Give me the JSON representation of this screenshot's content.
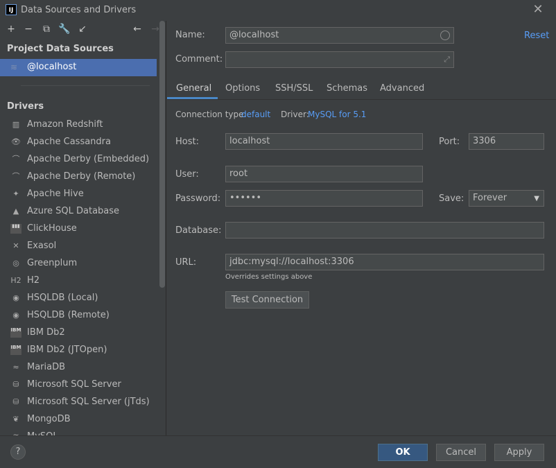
{
  "window": {
    "icon_text": "IJ",
    "title": "Data Sources and Drivers",
    "close_glyph": "✕"
  },
  "toolbar": {
    "icons": [
      {
        "name": "add-icon",
        "glyph": "+"
      },
      {
        "name": "remove-icon",
        "glyph": "−"
      },
      {
        "name": "copy-icon",
        "glyph": "⧉"
      },
      {
        "name": "wrench-icon",
        "glyph": "🔧"
      },
      {
        "name": "import-icon",
        "glyph": "↙"
      },
      {
        "name": "back-arrow-icon",
        "glyph": "←"
      },
      {
        "name": "forward-arrow-icon",
        "glyph": "→"
      }
    ]
  },
  "sidebar": {
    "project_title": "Project Data Sources",
    "selected_source": "@localhost",
    "drivers_title": "Drivers",
    "drivers": [
      {
        "label": "Amazon Redshift",
        "icon": "redshift-icon",
        "glyph": "▥"
      },
      {
        "label": "Apache Cassandra",
        "icon": "cassandra-icon",
        "glyph": "👁"
      },
      {
        "label": "Apache Derby (Embedded)",
        "icon": "derby-icon",
        "glyph": "⌒"
      },
      {
        "label": "Apache Derby (Remote)",
        "icon": "derby-icon",
        "glyph": "⌒"
      },
      {
        "label": "Apache Hive",
        "icon": "hive-icon",
        "glyph": "✦"
      },
      {
        "label": "Azure SQL Database",
        "icon": "azure-icon",
        "glyph": "▲"
      },
      {
        "label": "ClickHouse",
        "icon": "clickhouse-icon",
        "glyph": "▮▮▮"
      },
      {
        "label": "Exasol",
        "icon": "exasol-icon",
        "glyph": "✕"
      },
      {
        "label": "Greenplum",
        "icon": "greenplum-icon",
        "glyph": "◎"
      },
      {
        "label": "H2",
        "icon": "h2-icon",
        "glyph": "H2"
      },
      {
        "label": "HSQLDB (Local)",
        "icon": "hsqldb-icon",
        "glyph": "◉"
      },
      {
        "label": "HSQLDB (Remote)",
        "icon": "hsqldb-icon",
        "glyph": "◉"
      },
      {
        "label": "IBM Db2",
        "icon": "db2-icon",
        "glyph": "IBM"
      },
      {
        "label": "IBM Db2 (JTOpen)",
        "icon": "db2-icon",
        "glyph": "IBM"
      },
      {
        "label": "MariaDB",
        "icon": "mariadb-icon",
        "glyph": "≈"
      },
      {
        "label": "Microsoft SQL Server",
        "icon": "sqlserver-icon",
        "glyph": "⛁"
      },
      {
        "label": "Microsoft SQL Server (jTds)",
        "icon": "sqlserver-icon",
        "glyph": "⛁"
      },
      {
        "label": "MongoDB",
        "icon": "mongodb-icon",
        "glyph": "❦"
      },
      {
        "label": "MySQL",
        "icon": "mysql-icon",
        "glyph": "≋"
      }
    ]
  },
  "form": {
    "name_label": "Name:",
    "name_value": "@localhost",
    "comment_label": "Comment:",
    "comment_value": "",
    "reset_label": "Reset",
    "tabs": [
      "General",
      "Options",
      "SSH/SSL",
      "Schemas",
      "Advanced"
    ],
    "connection_type_label": "Connection type:",
    "connection_type_value": "default",
    "driver_label": "Driver:",
    "driver_value": "MySQL for 5.1",
    "host_label": "Host:",
    "host_value": "localhost",
    "port_label": "Port:",
    "port_value": "3306",
    "user_label": "User:",
    "user_value": "root",
    "password_label": "Password:",
    "password_value": "••••••",
    "save_label": "Save:",
    "save_value": "Forever",
    "database_label": "Database:",
    "database_value": "",
    "url_label": "URL:",
    "url_value": "jdbc:mysql://localhost:3306",
    "url_hint": "Overrides settings above",
    "test_connection_label": "Test Connection"
  },
  "footer": {
    "help_label": "?",
    "ok_label": "OK",
    "cancel_label": "Cancel",
    "apply_label": "Apply"
  }
}
